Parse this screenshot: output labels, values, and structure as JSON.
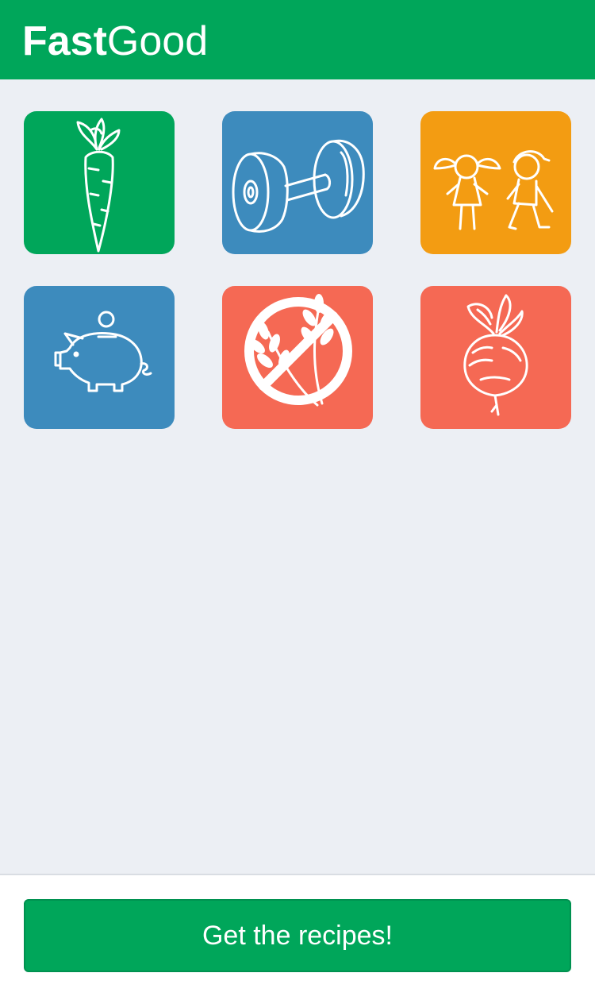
{
  "app": {
    "brand_strong": "Fast",
    "brand_light": "Good"
  },
  "colors": {
    "header": "#00a65a",
    "background": "#eceff4",
    "green": "#00a65a",
    "blue": "#3d8bbd",
    "orange": "#f39c12",
    "coral": "#f56954"
  },
  "categories": [
    {
      "icon": "carrot-icon",
      "color": "#00a65a"
    },
    {
      "icon": "dumbbell-icon",
      "color": "#3d8bbd"
    },
    {
      "icon": "kids-icon",
      "color": "#f39c12"
    },
    {
      "icon": "piggy-bank-icon",
      "color": "#3d8bbd"
    },
    {
      "icon": "gluten-free-icon",
      "color": "#f56954"
    },
    {
      "icon": "beet-icon",
      "color": "#f56954"
    }
  ],
  "footer": {
    "cta_label": "Get the recipes!"
  }
}
